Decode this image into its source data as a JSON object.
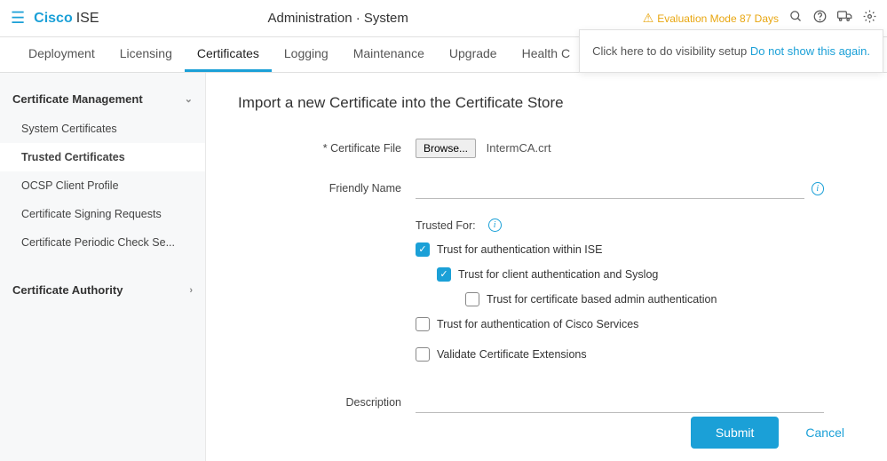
{
  "header": {
    "brand": "Cisco",
    "brand_suffix": "ISE",
    "breadcrumb": "Administration · System",
    "eval_text": "Evaluation Mode 87 Days"
  },
  "notification": {
    "text": "Click here to do visibility setup ",
    "link": "Do not show this again."
  },
  "tabs": [
    "Deployment",
    "Licensing",
    "Certificates",
    "Logging",
    "Maintenance",
    "Upgrade",
    "Health C"
  ],
  "sidebar": {
    "group1": "Certificate Management",
    "items1": [
      "System Certificates",
      "Trusted Certificates",
      "OCSP Client Profile",
      "Certificate Signing Requests",
      "Certificate Periodic Check Se..."
    ],
    "group2": "Certificate Authority"
  },
  "page": {
    "title": "Import a new Certificate into the Certificate Store",
    "labels": {
      "cert_file": "* Certificate File",
      "friendly_name": "Friendly Name",
      "trusted_for": "Trusted For:",
      "description": "Description"
    },
    "browse_btn": "Browse...",
    "file_name": "IntermCA.crt",
    "friendly_value": "",
    "description_value": "",
    "checkboxes": {
      "auth_ise": "Trust for authentication within ISE",
      "client_syslog": "Trust for client authentication and Syslog",
      "cert_admin": "Trust for certificate based admin authentication",
      "cisco_services": "Trust for authentication of Cisco Services",
      "validate_ext": "Validate Certificate Extensions"
    },
    "buttons": {
      "submit": "Submit",
      "cancel": "Cancel"
    }
  }
}
